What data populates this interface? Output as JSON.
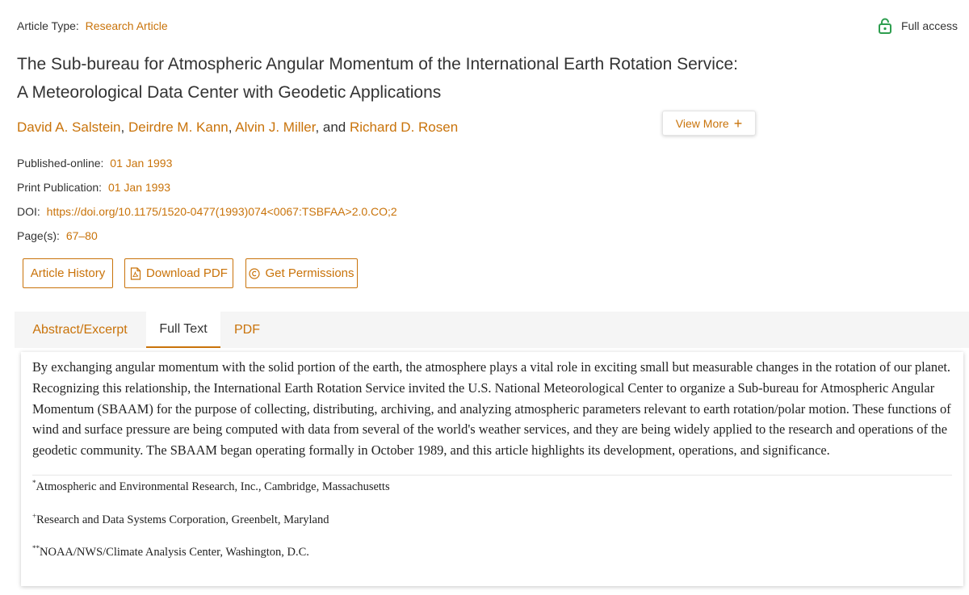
{
  "article_type": {
    "label": "Article Type:",
    "value": "Research Article"
  },
  "access": {
    "label": "Full access",
    "icon": "lock-open-icon",
    "icon_color": "#2e9e4f"
  },
  "title": "The Sub-bureau for Atmospheric Angular Momentum of the International Earth Rotation Service: A Meteorological Data Center with Geodetic Applications",
  "authors": {
    "names": [
      "David A. Salstein",
      "Deirdre M. Kann",
      "Alvin J. Miller",
      "Richard D. Rosen"
    ],
    "sep1": ", ",
    "sep2": ", ",
    "sep3": ", and "
  },
  "view_more": {
    "label": "View More",
    "icon": "plus-icon"
  },
  "published_online": {
    "label": "Published-online:",
    "value": "01 Jan 1993"
  },
  "print_publication": {
    "label": "Print Publication:",
    "value": "01 Jan 1993"
  },
  "doi": {
    "label": "DOI:",
    "value": "https://doi.org/10.1175/1520-0477(1993)074<0067:TSBFAA>2.0.CO;2"
  },
  "pages": {
    "label": "Page(s):",
    "value": "67–80"
  },
  "buttons": {
    "history": "Article History",
    "pdf": "Download PDF",
    "pdf_icon": "pdf-file-icon",
    "permissions": "Get Permissions",
    "permissions_icon": "copyright-icon"
  },
  "tabs": [
    {
      "label": "Abstract/Excerpt",
      "active": false
    },
    {
      "label": "Full Text",
      "active": true
    },
    {
      "label": "PDF",
      "active": false
    }
  ],
  "abstract": "By exchanging angular momentum with the solid portion of the earth, the atmosphere plays a vital role in exciting small but measurable changes in the rotation of our planet. Recognizing this relationship, the International Earth Rotation Service invited the U.S. National Meteorological Center to organize a Sub-bureau for Atmospheric Angular Momentum (SBAAM) for the purpose of collecting, distributing, archiving, and analyzing atmospheric parameters relevant to earth rotation/polar motion. These functions of wind and surface pressure are being computed with data from several of the world's weather services, and they are being widely applied to the research and operations of the geodetic community. The SBAAM began operating formally in October 1989, and this article highlights its development, operations, and significance.",
  "affiliations": [
    {
      "mark": "*",
      "text": "Atmospheric and Environmental Research, Inc., Cambridge, Massachusetts"
    },
    {
      "mark": "+",
      "text": "Research and Data Systems Corporation, Greenbelt, Maryland"
    },
    {
      "mark": "**",
      "text": "NOAA/NWS/Climate Analysis Center, Washington, D.C."
    }
  ],
  "colors": {
    "accent": "#c9730a",
    "text": "#333333",
    "tab_bar": "#f5f5f5"
  }
}
